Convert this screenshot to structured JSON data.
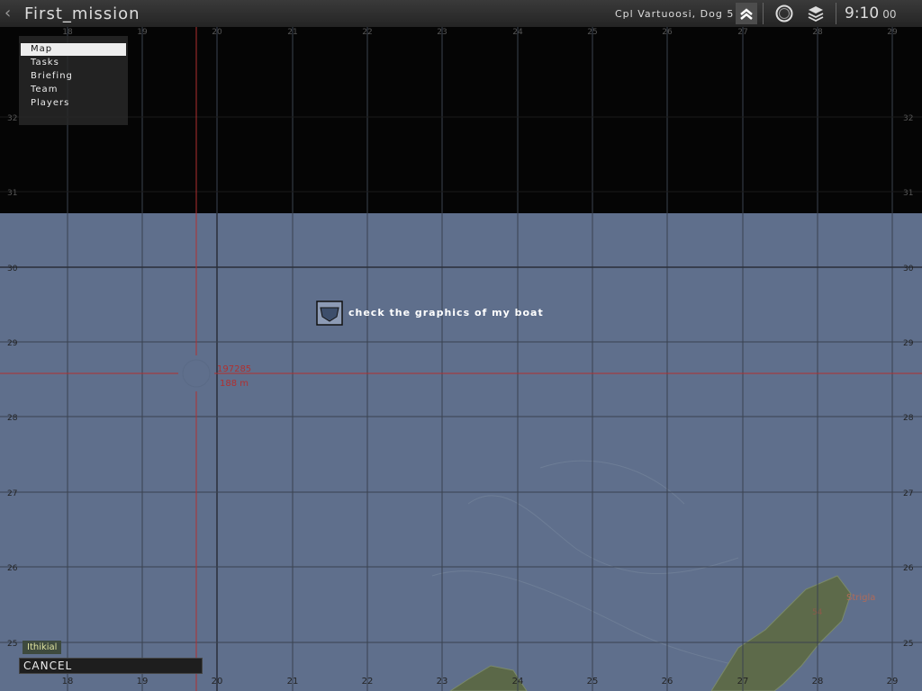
{
  "topbar": {
    "back_label": "‹",
    "mission_title": "First_mission",
    "player_label": "Cpl Vartuoosi, Dog  5",
    "time": "9:10",
    "seconds": "00"
  },
  "menu": {
    "items": [
      "Map",
      "Tasks",
      "Briefing",
      "Team",
      "Players"
    ],
    "selected": "Map"
  },
  "map": {
    "grid_x_labels": [
      "18",
      "19",
      "20",
      "21",
      "22",
      "23",
      "24",
      "25",
      "26",
      "27",
      "28",
      "29"
    ],
    "grid_y_labels_sea": [
      "30",
      "29",
      "28",
      "27",
      "26",
      "25"
    ],
    "grid_y_labels_dark": [
      "32",
      "31"
    ],
    "marker_text": "check the graphics of my boat",
    "cursor_grid": "197285",
    "cursor_distance": "188 m",
    "town_label": "Strigla",
    "height_label": "54",
    "location_name": "Ithikial",
    "colors": {
      "sea": "#5f6f8c",
      "dark": "#050505",
      "cursor": "#b03030",
      "land": "#5d6a4a"
    }
  },
  "cancel_label": "CANCEL"
}
